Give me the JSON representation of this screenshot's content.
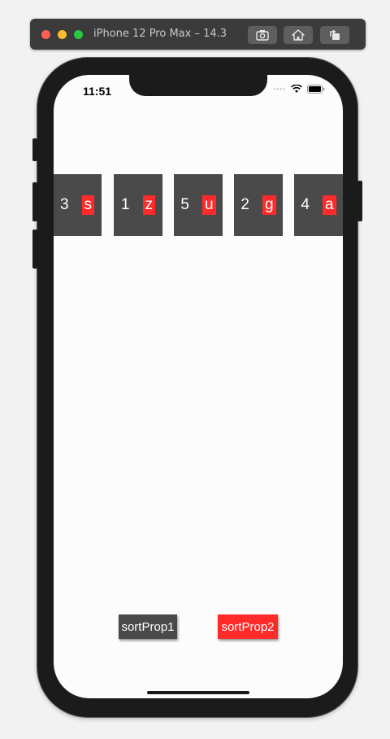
{
  "simulator": {
    "title": "iPhone 12 Pro Max – 14.3",
    "buttons": [
      {
        "icon": "camera-icon"
      },
      {
        "icon": "home-icon"
      },
      {
        "icon": "rotate-icon"
      }
    ]
  },
  "status_bar": {
    "time": "11:51",
    "icons": [
      "signal-icon",
      "wifi-icon",
      "battery-icon"
    ]
  },
  "cards": [
    {
      "number": "3",
      "letter": "s"
    },
    {
      "number": "1",
      "letter": "z"
    },
    {
      "number": "5",
      "letter": "u"
    },
    {
      "number": "2",
      "letter": "g"
    },
    {
      "number": "4",
      "letter": "a"
    }
  ],
  "buttons": {
    "sort_prop1": "sortProp1",
    "sort_prop2": "sortProp2"
  },
  "colors": {
    "card_background": "#4a4a4a",
    "accent_red": "#ff2a2a"
  }
}
